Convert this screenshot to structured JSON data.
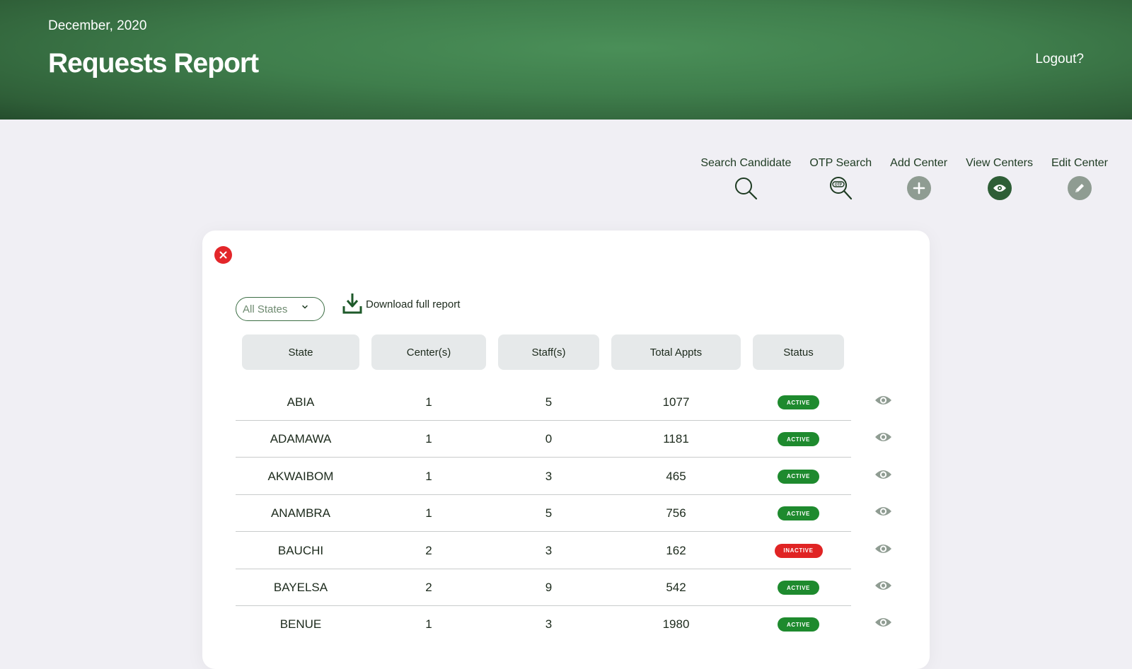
{
  "header": {
    "date": "December, 2020",
    "title": "Requests Report",
    "logout": "Logout?"
  },
  "toolbar": {
    "search_candidate": {
      "label": "Search Candidate",
      "icon": "search-icon"
    },
    "otp_search": {
      "label": "OTP Search",
      "icon": "otp-search-icon"
    },
    "add_center": {
      "label": "Add Center",
      "icon": "plus-icon"
    },
    "view_centers": {
      "label": "View Centers",
      "icon": "eye-icon"
    },
    "edit_center": {
      "label": "Edit Center",
      "icon": "pencil-icon"
    }
  },
  "filters": {
    "state_select": "All States",
    "download_label": "Download full report"
  },
  "table": {
    "headers": [
      "State",
      "Center(s)",
      "Staff(s)",
      "Total Appts",
      "Status"
    ],
    "rows": [
      {
        "state": "ABIA",
        "centers": "1",
        "staffs": "5",
        "appts": "1077",
        "status": "ACTIVE"
      },
      {
        "state": "ADAMAWA",
        "centers": "1",
        "staffs": "0",
        "appts": "1181",
        "status": "ACTIVE"
      },
      {
        "state": "AKWAIBOM",
        "centers": "1",
        "staffs": "3",
        "appts": "465",
        "status": "ACTIVE"
      },
      {
        "state": "ANAMBRA",
        "centers": "1",
        "staffs": "5",
        "appts": "756",
        "status": "ACTIVE"
      },
      {
        "state": "BAUCHI",
        "centers": "2",
        "staffs": "3",
        "appts": "162",
        "status": "INACTIVE"
      },
      {
        "state": "BAYELSA",
        "centers": "2",
        "staffs": "9",
        "appts": "542",
        "status": "ACTIVE"
      },
      {
        "state": "BENUE",
        "centers": "1",
        "staffs": "3",
        "appts": "1980",
        "status": "ACTIVE"
      }
    ]
  },
  "colors": {
    "header_green": "#3f7e4c",
    "active": "#1e8a2e",
    "inactive": "#e02424",
    "close": "#e3262a",
    "view_centers_icon": "#2e5e36",
    "muted_icon": "#8f9c92"
  }
}
